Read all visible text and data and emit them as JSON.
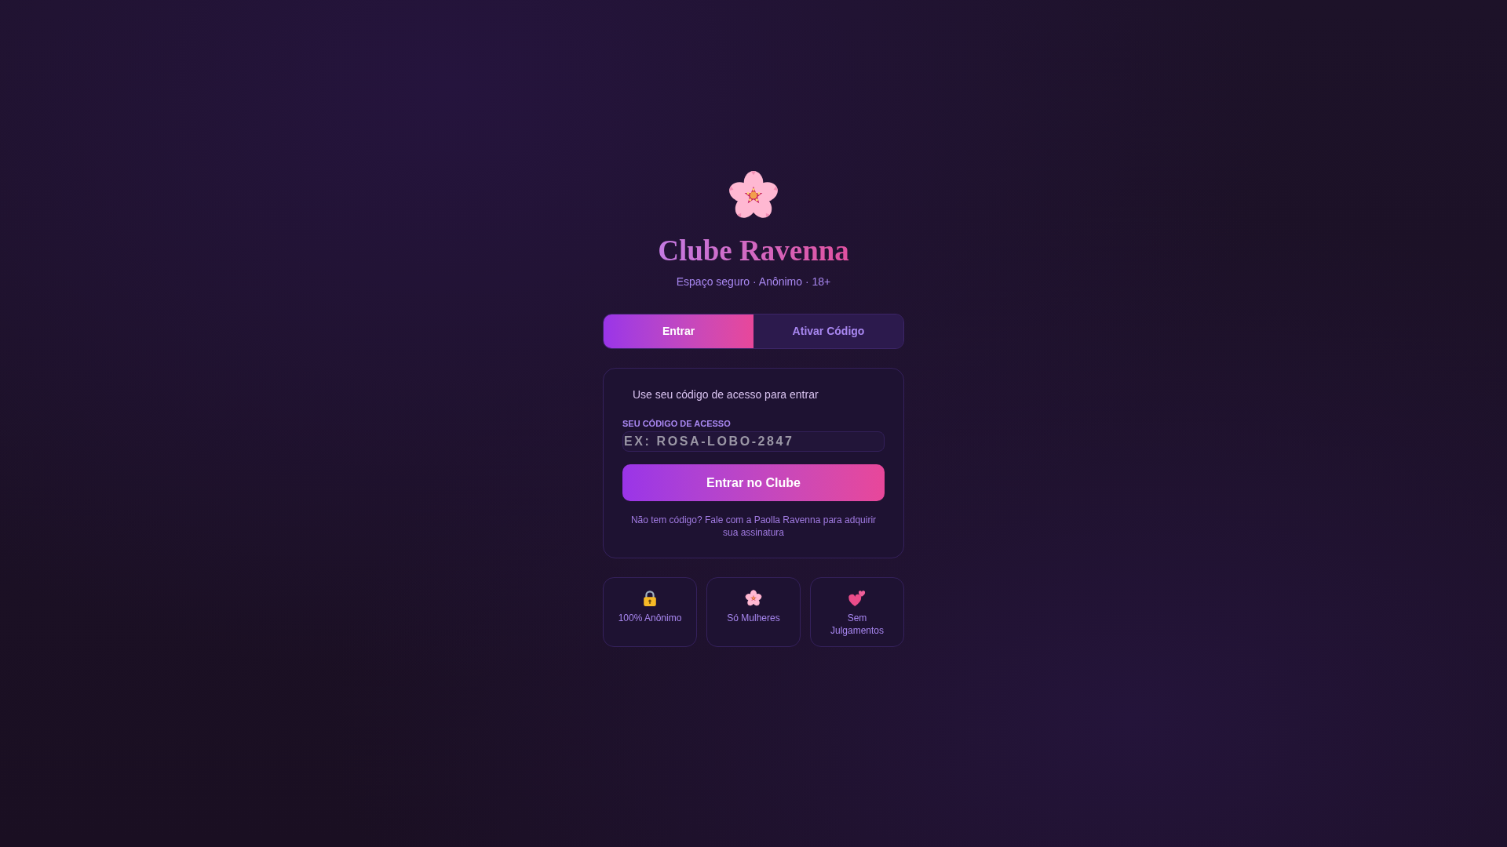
{
  "brand": {
    "title": "Clube Ravenna",
    "tagline": "Espaço seguro · Anônimo · 18+"
  },
  "tabs": [
    {
      "label": "Entrar",
      "selected": true
    },
    {
      "label": "Ativar Código",
      "selected": false
    }
  ],
  "login_card": {
    "intro": "Use seu código de acesso para entrar",
    "field": {
      "label": "SEU CÓDIGO DE ACESSO",
      "placeholder": "EX: ROSA-LOBO-2847"
    },
    "submit": "Entrar no Clube",
    "help": "Não tem código? Fale com a Paolla Ravenna para adquirir sua assinatura"
  },
  "features": [
    {
      "kind": "lock",
      "label": "100% Anônimo"
    },
    {
      "kind": "flower",
      "label": "Só Mulheres"
    },
    {
      "kind": "hearts",
      "label": "Sem Julgamentos"
    }
  ]
}
